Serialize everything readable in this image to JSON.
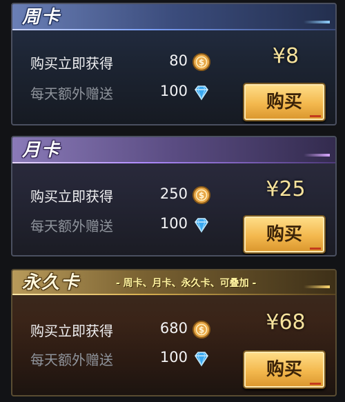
{
  "cards": [
    {
      "title": "周卡",
      "instant_label": "购买立即获得",
      "instant_amount": "80",
      "daily_label": "每天额外赠送",
      "daily_amount": "100",
      "price": "¥8",
      "buy_label": "购买"
    },
    {
      "title": "月卡",
      "instant_label": "购买立即获得",
      "instant_amount": "250",
      "daily_label": "每天额外赠送",
      "daily_amount": "100",
      "price": "¥25",
      "buy_label": "购买"
    },
    {
      "title": "永久卡",
      "note": "- 周卡、月卡、永久卡、可叠加 -",
      "instant_label": "购买立即获得",
      "instant_amount": "680",
      "daily_label": "每天额外赠送",
      "daily_amount": "100",
      "price": "¥68",
      "buy_label": "购买"
    }
  ],
  "icons": {
    "instant_reward": "gold-coin-icon",
    "daily_reward": "diamond-icon"
  },
  "colors": {
    "price_text": "#f6e29c",
    "buy_button": "#f3b84e",
    "coin": "#e8a848",
    "diamond": "#3aa8f0"
  }
}
